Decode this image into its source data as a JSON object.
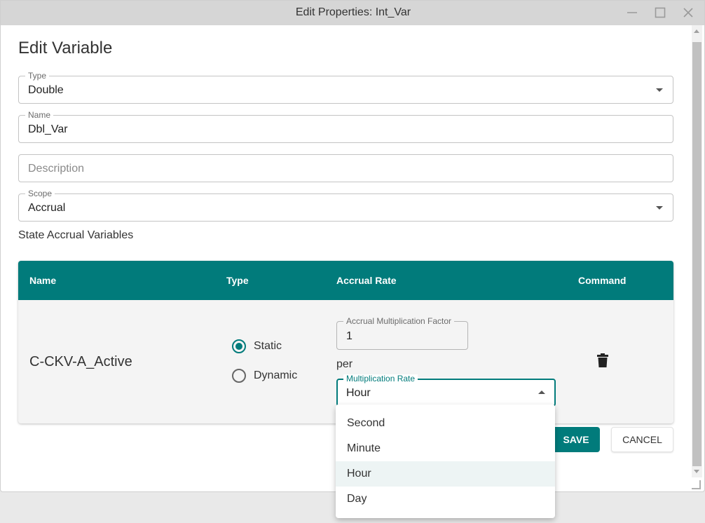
{
  "window": {
    "title": "Edit Properties: Int_Var"
  },
  "dialog": {
    "heading": "Edit Variable"
  },
  "fields": {
    "type": {
      "label": "Type",
      "value": "Double"
    },
    "name": {
      "label": "Name",
      "value": "Dbl_Var"
    },
    "description": {
      "placeholder": "Description",
      "value": ""
    },
    "scope": {
      "label": "Scope",
      "value": "Accrual"
    }
  },
  "section_title": "State Accrual Variables",
  "grid": {
    "columns": [
      "Name",
      "Type",
      "Accrual Rate",
      "Command"
    ],
    "row": {
      "name": "C-CKV-A_Active",
      "type_options": [
        {
          "label": "Static",
          "selected": true
        },
        {
          "label": "Dynamic",
          "selected": false
        }
      ],
      "factor_label": "Accrual Multiplication Factor",
      "factor_value": "1",
      "per": "per",
      "rate_label": "Multiplication Rate",
      "rate_value": "Hour",
      "command_icon": "trash-icon"
    }
  },
  "rate_menu": {
    "options": [
      "Second",
      "Minute",
      "Hour",
      "Day"
    ],
    "selected": "Hour"
  },
  "buttons": {
    "save": "SAVE",
    "cancel": "CANCEL"
  },
  "colors": {
    "accent": "#017b7b",
    "titlebar": "#d6d6d6",
    "menu_highlight": "#edf4f4"
  }
}
